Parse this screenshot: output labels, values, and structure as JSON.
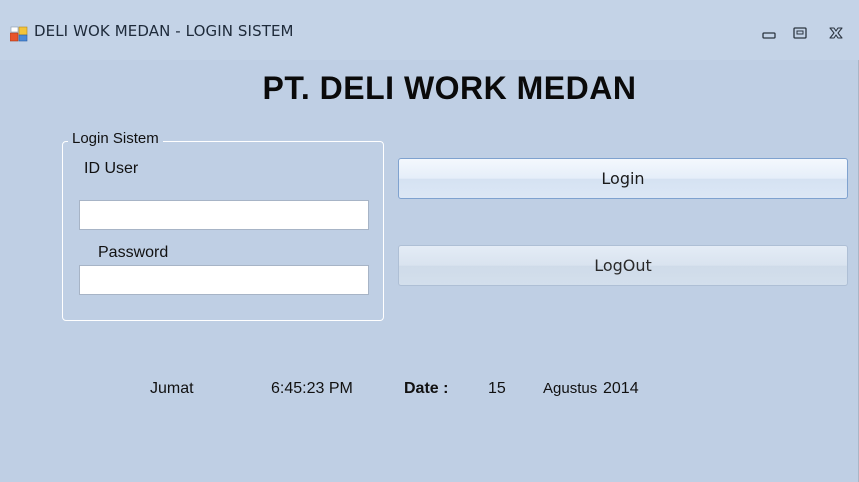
{
  "window": {
    "title": "DELI WOK MEDAN - LOGIN SISTEM",
    "controls": {
      "minimize": "minimize-icon",
      "maximize": "maximize-icon",
      "close": "close-icon"
    }
  },
  "heading": "PT. DELI WORK MEDAN",
  "login_group": {
    "legend": "Login Sistem",
    "user_label": "ID User",
    "user_value": "",
    "password_label": "Password",
    "password_value": ""
  },
  "buttons": {
    "login_label": "Login",
    "logout_label": "LogOut"
  },
  "status": {
    "day": "Jumat",
    "time": "6:45:23 PM",
    "date_label": "Date :",
    "date_day": "15",
    "month": "Agustus",
    "year": "2014"
  },
  "colors": {
    "window_bg": "#bfcfe4",
    "button_border": "#7fa2cf"
  }
}
